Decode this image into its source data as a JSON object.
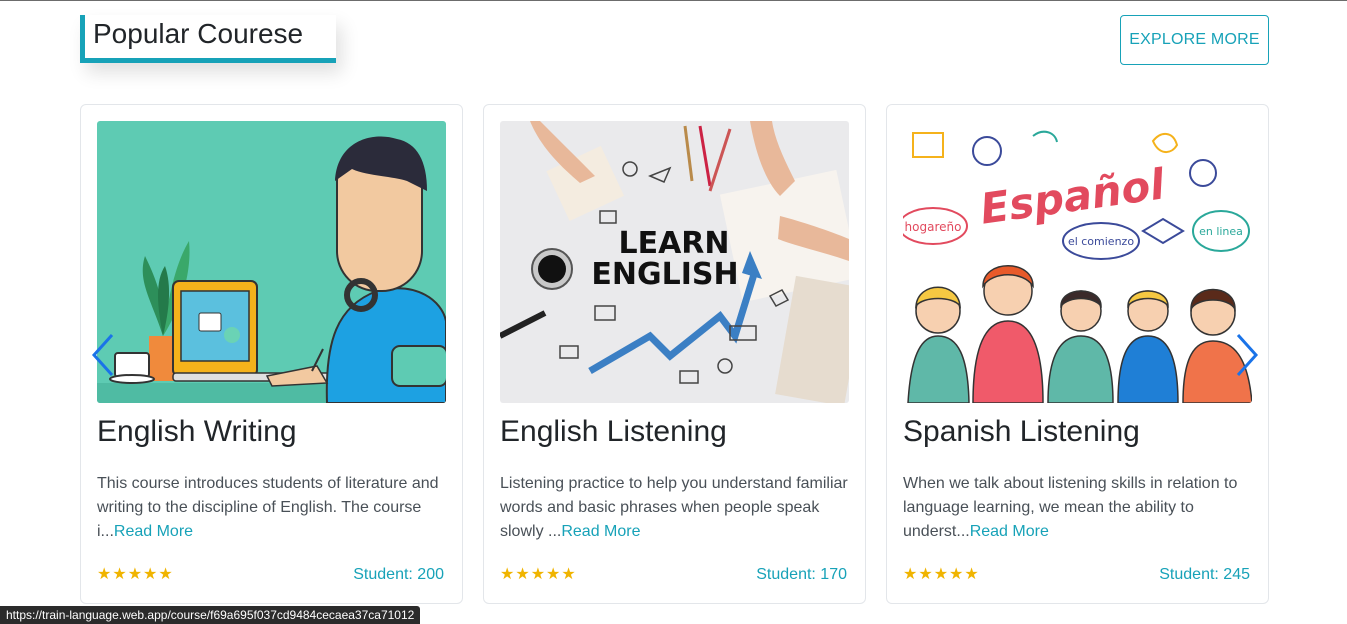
{
  "section": {
    "title": "Popular Courese",
    "explore_label": "EXPLORE MORE"
  },
  "courses": [
    {
      "title": "English Writing",
      "description": "This course introduces students of literature and writing to the discipline of English. The course i...",
      "read_more": "Read More",
      "rating_stars": "★★★★★",
      "students": "Student: 200"
    },
    {
      "title": "English Listening",
      "description": "Listening practice to help you understand familiar words and basic phrases when people speak slowly ...",
      "read_more": "Read More",
      "rating_stars": "★★★★★",
      "students": "Student: 170",
      "image_text": [
        "LEARN",
        "ENGLISH"
      ]
    },
    {
      "title": "Spanish Listening",
      "description": "When we talk about listening skills in relation to language learning, we mean the ability to underst...",
      "read_more": "Read More",
      "rating_stars": "★★★★★",
      "students": "Student: 245",
      "image_text": [
        "Español",
        "hogareño",
        "el comienzo",
        "en linea"
      ]
    }
  ],
  "carousel": {
    "prev_icon": "chevron-left-icon",
    "next_icon": "chevron-right-icon"
  },
  "status_bar": {
    "url": "https://train-language.web.app/course/f69a695f037cd9484cecaea37ca71012"
  },
  "colors": {
    "accent": "#17a2b8",
    "star": "#f0b400",
    "arrow": "#1a73e8"
  }
}
